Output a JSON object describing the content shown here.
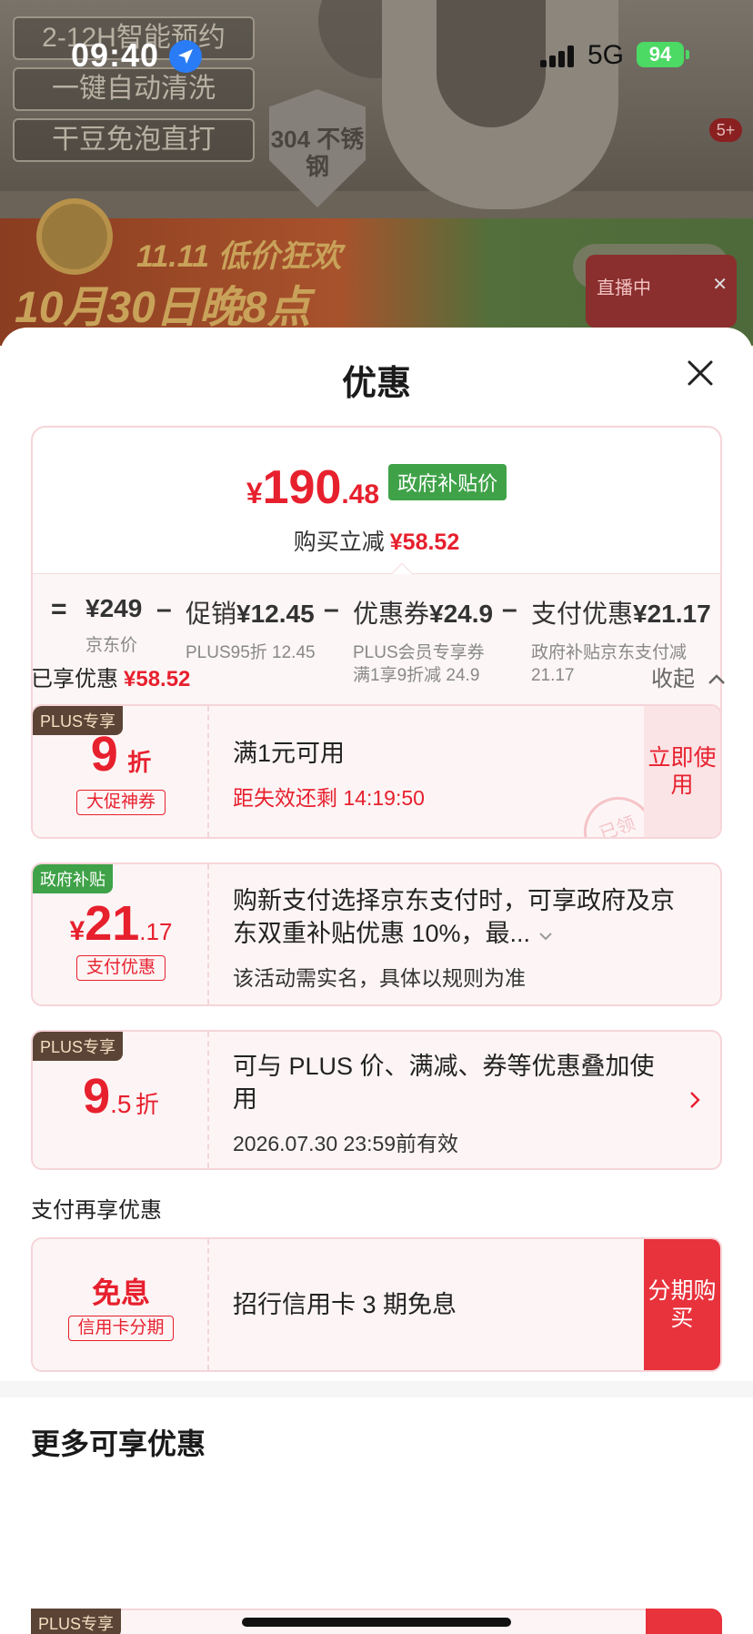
{
  "background": {
    "promo_lines": [
      "2-12H智能预约",
      "一键自动清洗",
      "干豆免泡直打"
    ],
    "shield_text": "304 不锈钢",
    "banner_line1": "11.11 低价狂欢",
    "banner_line2": "10月30日晚8点",
    "live_label": "直播中",
    "badge": "5+"
  },
  "status_bar": {
    "time": "09:40",
    "network": "5G",
    "battery": "94"
  },
  "sheet": {
    "title": "优惠",
    "summary": {
      "price_yen": "¥",
      "price_int": "190",
      "price_dec": ".48",
      "gov_tag": "政府补贴价",
      "saving_label": "购买立减",
      "saving_value": "¥58.52",
      "calc": {
        "eq": "=",
        "minus": "–",
        "jd_price": "¥249",
        "jd_label": "京东价",
        "promo_label": "促销",
        "promo_value": "¥12.45",
        "promo_sub": "PLUS95折 12.45",
        "coupon_label": "优惠券",
        "coupon_value": "¥24.9",
        "coupon_sub": "PLUS会员专享券满1享9折减 24.9",
        "pay_label": "支付优惠",
        "pay_value": "¥21.17",
        "pay_sub": "政府补贴京东支付减21.17"
      }
    },
    "enjoyed": {
      "label": "已享优惠",
      "value": "¥58.52",
      "collapse_label": "收起"
    },
    "coupons": [
      {
        "tag": "PLUS专享",
        "big": "9",
        "unit": "折",
        "chip": "大促神券",
        "title": "满1元可用",
        "subtitle": "距失效还剩 14:19:50",
        "action": "立即使用",
        "stamp": "已领"
      },
      {
        "tag": "政府补贴",
        "yen": "¥",
        "big": "21",
        "dec": ".17",
        "chip": "支付优惠",
        "title": "购新支付选择京东支付时，可享政府及京东双重补贴优惠 10%，最...",
        "subtitle": "该活动需实名，具体以规则为准"
      },
      {
        "tag": "PLUS专享",
        "big": "9",
        "dec": ".5",
        "unit": "折",
        "title": "可与 PLUS 价、满减、券等优惠叠加使用",
        "subtitle": "2026.07.30 23:59前有效"
      }
    ],
    "pay_section": {
      "label": "支付再享优惠",
      "card": {
        "big": "免息",
        "chip": "信用卡分期",
        "title": "招行信用卡 3 期免息",
        "action": "分期购买"
      }
    },
    "more": {
      "title": "更多可享优惠",
      "tag": "PLUS专享"
    }
  },
  "colors": {
    "accent_red": "#e7202e",
    "gov_green": "#3fa248",
    "plus_brown": "#5b4436"
  }
}
